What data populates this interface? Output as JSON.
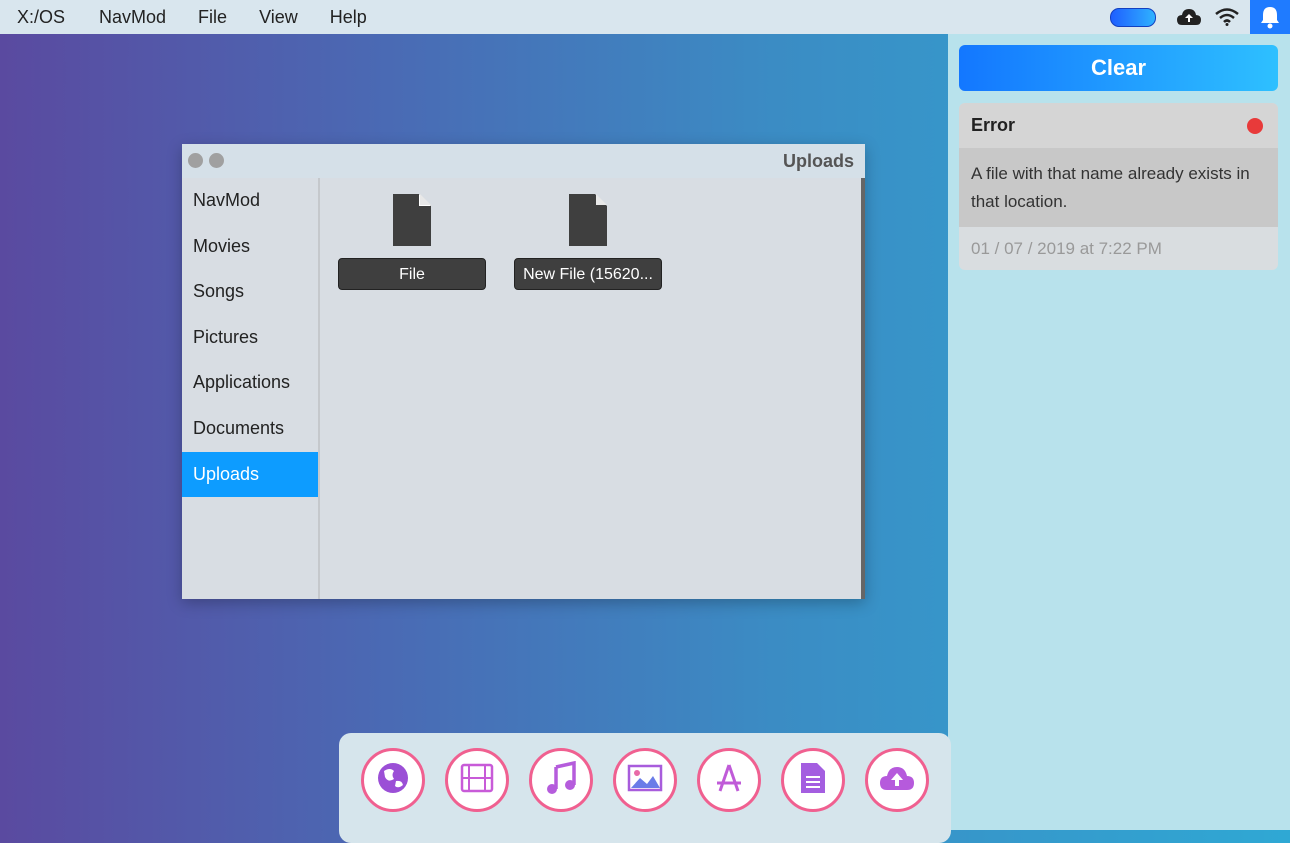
{
  "menubar": {
    "items": [
      "X:/OS",
      "NavMod",
      "File",
      "View",
      "Help"
    ],
    "icons": [
      "toggle-switch",
      "cloud-upload-icon",
      "wifi-icon",
      "bell-icon"
    ]
  },
  "notifications": {
    "clear_label": "Clear",
    "items": [
      {
        "title": "Error",
        "message": "A file with that name already exists in that location.",
        "timestamp": "01 / 07 / 2019 at 7:22 PM",
        "status_color": "#e83a3a"
      }
    ]
  },
  "window": {
    "title": "Uploads",
    "sidebar": [
      "NavMod",
      "Movies",
      "Songs",
      "Pictures",
      "Applications",
      "Documents",
      "Uploads"
    ],
    "active_sidebar": "Uploads",
    "files": [
      {
        "name": "File",
        "icon": "file-icon"
      },
      {
        "name": "New File (15620...",
        "icon": "file-icon"
      }
    ]
  },
  "dock": {
    "apps": [
      "globe-icon",
      "film-icon",
      "music-icon",
      "picture-icon",
      "app-store-icon",
      "document-icon",
      "cloud-upload-icon"
    ]
  },
  "colors": {
    "accent": "#0d9cff",
    "clear_button": "#1377ff",
    "dock_ring": "#f06090"
  }
}
